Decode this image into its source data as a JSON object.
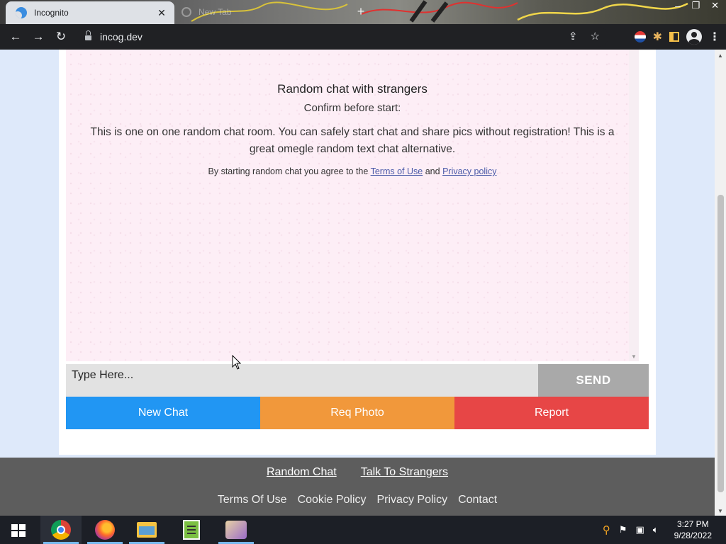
{
  "browser": {
    "tabs": [
      {
        "title": "Incognito",
        "active": true
      },
      {
        "title": "New Tab",
        "active": false
      }
    ],
    "url": "incog.dev"
  },
  "chat": {
    "intro_title": "Random chat with strangers",
    "intro_confirm": "Confirm before start:",
    "intro_desc": "This is one on one random chat room. You can safely start chat and share pics without registration! This is a great omegle random text chat alternative.",
    "terms_prefix": "By starting random chat you agree to the",
    "terms_link": "Terms of Use",
    "terms_and": "and",
    "privacy_link": "Privacy policy",
    "input_placeholder": "Type Here...",
    "send_label": "SEND"
  },
  "actions": {
    "new_chat": "New Chat",
    "req_photo": "Req Photo",
    "report": "Report"
  },
  "footer": {
    "top_links": [
      "Random Chat",
      "Talk To Strangers"
    ],
    "bottom_links": [
      "Terms Of Use",
      "Cookie Policy",
      "Privacy Policy",
      "Contact"
    ]
  },
  "taskbar": {
    "time": "3:27 PM",
    "date": "9/28/2022"
  },
  "colors": {
    "new_chat": "#2196f3",
    "req_photo": "#f1983b",
    "report": "#e74646",
    "send": "#a9a9a9",
    "chat_bg": "#fdeef6",
    "footer_bg": "#5d5d5d"
  }
}
